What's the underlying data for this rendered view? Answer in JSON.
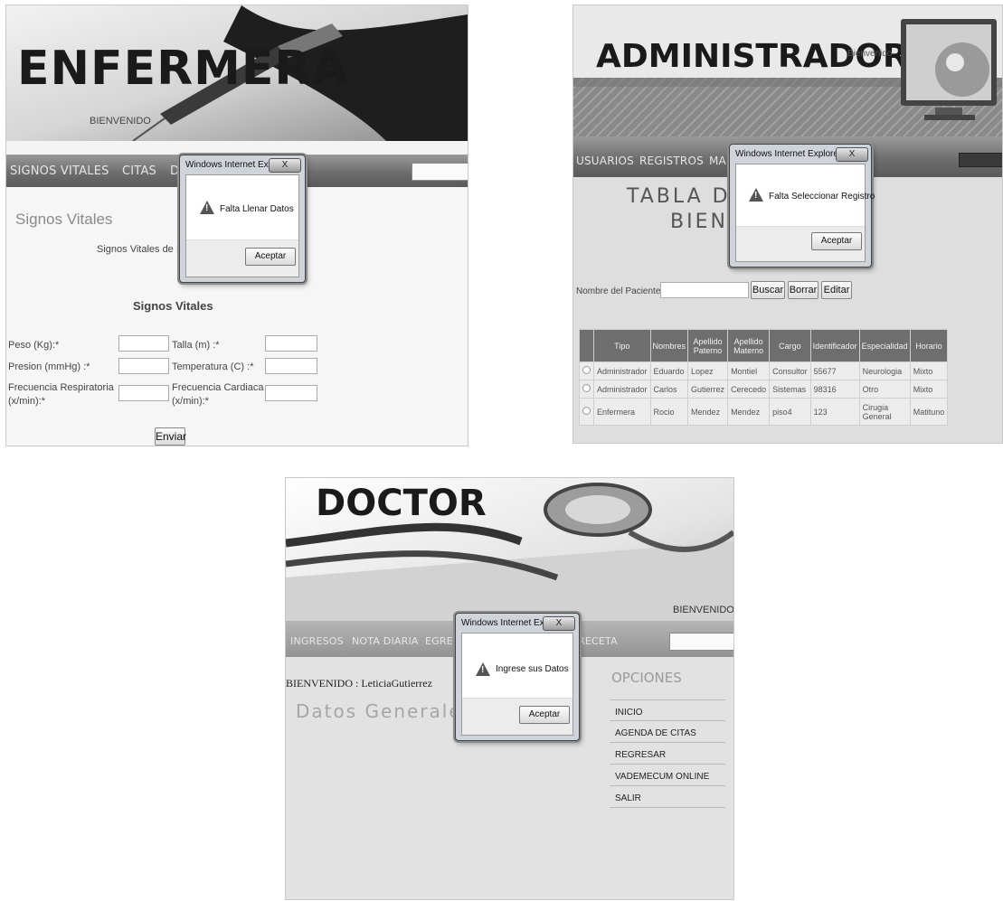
{
  "enfermera": {
    "banner_title": "ENFERMERA",
    "banner_subtitle": "BIENVENIDO",
    "nav": [
      "SIGNOS VITALES",
      "CITAS",
      "DOCTO"
    ],
    "section_title": "Signos Vitales",
    "patient_line": "Signos Vitales de :Eric",
    "form_title": "Signos Vitales",
    "fields": {
      "peso": "Peso (Kg):*",
      "talla": "Talla (m) :*",
      "presion": "Presion (mmHg) :*",
      "temperatura": "Temperatura (C) :*",
      "frec_resp_1": "Frecuencia Respiratoria",
      "frec_resp_2": "(x/min):*",
      "frec_card_1": "Frecuencia Cardiaca",
      "frec_card_2": "(x/min):*"
    },
    "submit": "Enviar",
    "dialog": {
      "title": "Windows Internet Explorer",
      "close": "X",
      "message": "Falta Llenar Datos",
      "button": "Aceptar"
    }
  },
  "administrador": {
    "banner_title": "ADMINISTRADOR",
    "banner_welcome": "Bienvenido",
    "nav": [
      "USUARIOS",
      "REGISTROS",
      "MANT"
    ],
    "heading_1": "TABLA DE U",
    "heading_2": "BIENVE",
    "search_label": "Nombre del Paciente :",
    "buttons": {
      "buscar": "Buscar",
      "borrar": "Borrar",
      "editar": "Editar"
    },
    "table": {
      "headers": [
        "Tipo",
        "Nombres",
        "Apellido Paterno",
        "Apellido Materno",
        "Cargo",
        "Identificador",
        "Especialidad",
        "Horario"
      ],
      "rows": [
        [
          "Administrador",
          "Eduardo",
          "Lopez",
          "Montiel",
          "Consultor",
          "55677",
          "Neurologia",
          "Mixto"
        ],
        [
          "Administrador",
          "Carlos",
          "Gutierrez",
          "Cerecedo",
          "Sistemas",
          "98316",
          "Otro",
          "Mixto"
        ],
        [
          "Enfermera",
          "Rocio",
          "Mendez",
          "Mendez",
          "piso4",
          "123",
          "Cirugia General",
          "Matituno"
        ]
      ]
    },
    "dialog": {
      "title": "Windows Internet Explorer",
      "close": "X",
      "message": "Falta Seleccionar Registro",
      "button": "Aceptar"
    }
  },
  "doctor": {
    "banner_title": "DOCTOR",
    "banner_welcome": "BIENVENIDO",
    "nav": [
      "INGRESOS",
      "NOTA DIARIA",
      "EGRES",
      "RECETA"
    ],
    "welcome_line": "BIENVENIDO : LeticiaGutierrez",
    "section_title": "Datos Generales d",
    "options_title": "OPCIONES",
    "options": [
      "INICIO",
      "AGENDA DE CITAS",
      "REGRESAR",
      "VADEMECUM ONLINE",
      "SALIR"
    ],
    "dialog": {
      "title": "Windows Internet Explorer",
      "close": "X",
      "message": "Ingrese sus Datos",
      "button": "Aceptar"
    }
  }
}
